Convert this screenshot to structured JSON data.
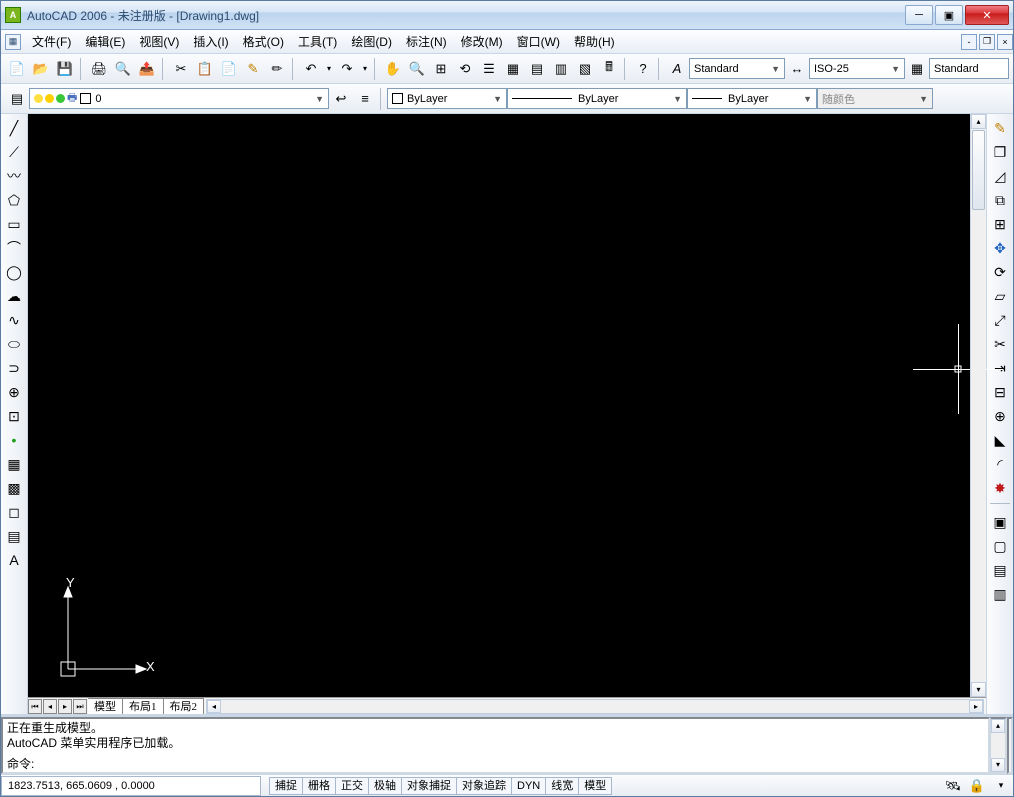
{
  "title": "AutoCAD 2006 - 未注册版 - [Drawing1.dwg]",
  "menu": {
    "file": "文件(F)",
    "edit": "编辑(E)",
    "view": "视图(V)",
    "insert": "插入(I)",
    "format": "格式(O)",
    "tools": "工具(T)",
    "draw": "绘图(D)",
    "dimension": "标注(N)",
    "modify": "修改(M)",
    "window": "窗口(W)",
    "help": "帮助(H)"
  },
  "styles": {
    "text_style": "Standard",
    "dim_style": "ISO-25",
    "table_style": "Standard"
  },
  "layers": {
    "current": "0",
    "color_dd": "随颜色",
    "linetype": "ByLayer",
    "lineweight": "ByLayer",
    "bylayer_label": "ByLayer"
  },
  "tabs": {
    "model": "模型",
    "layout1": "布局1",
    "layout2": "布局2"
  },
  "command": {
    "line1": "正在重生成模型。",
    "line2": "AutoCAD 菜单实用程序已加载。",
    "prompt": "命令:"
  },
  "status": {
    "coords": "1823.7513, 665.0609 , 0.0000",
    "snap": "捕捉",
    "grid": "栅格",
    "ortho": "正交",
    "polar": "极轴",
    "osnap": "对象捕捉",
    "otrack": "对象追踪",
    "dyn": "DYN",
    "lwt": "线宽",
    "model": "模型"
  },
  "ucs": {
    "x": "X",
    "y": "Y"
  }
}
